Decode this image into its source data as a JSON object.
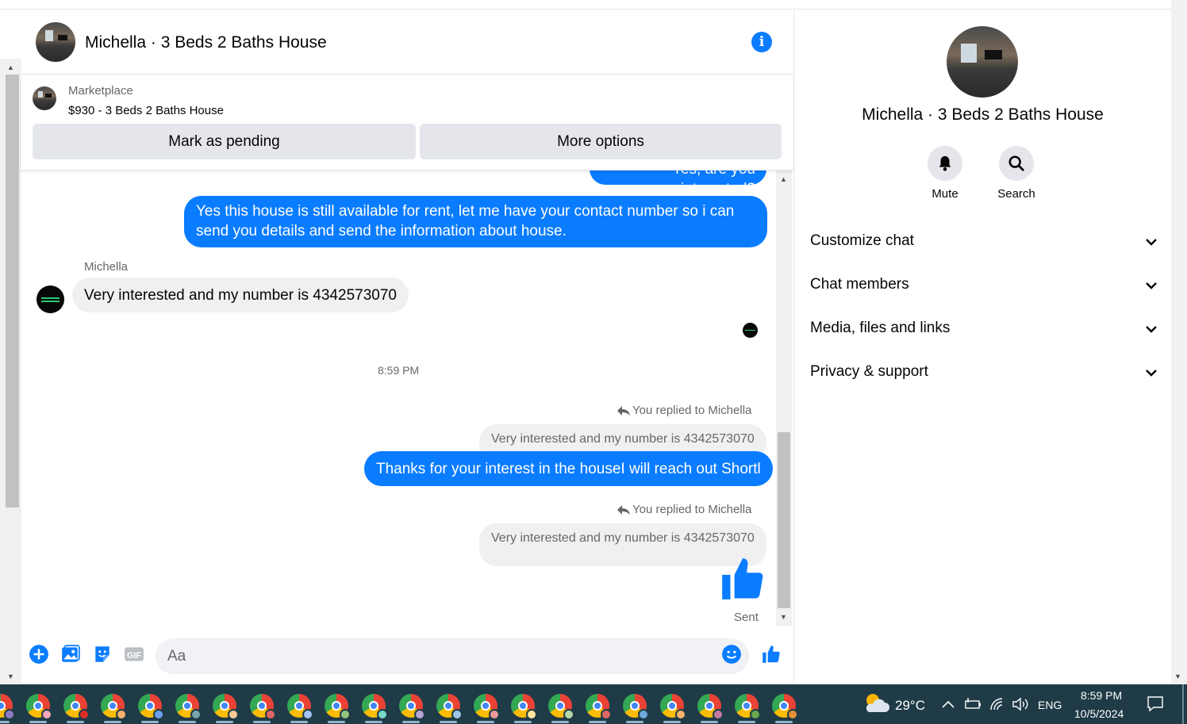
{
  "chat": {
    "title": "Michella · 3 Beds 2 Baths House",
    "marketplace": {
      "label": "Marketplace",
      "listing": "$930 - 3 Beds 2 Baths House",
      "pending_button": "Mark as pending",
      "more_button": "More options"
    },
    "messages": {
      "clipped_out": "Yes, are you interested?",
      "out_1": "Yes this house is still available for rent, let me have your contact number so i can send you details and send the information about house.",
      "sender_name": "Michella",
      "in_1": "Very interested and my number is 4342573070",
      "timestamp": "8:59 PM",
      "reply_note_1": "You replied to Michella",
      "quote_1": "Very interested and my number is 4342573070",
      "out_2": "Thanks for your interest in the houseI will reach out Shortl",
      "reply_note_2": "You replied to Michella",
      "quote_2": "Very interested and my number is 4342573070",
      "status": "Sent"
    },
    "composer": {
      "placeholder": "Aa"
    }
  },
  "right_panel": {
    "name": "Michella · 3 Beds 2 Baths House",
    "actions": [
      {
        "label": "Mute",
        "icon": "bell-icon"
      },
      {
        "label": "Search",
        "icon": "search-icon"
      }
    ],
    "sections": [
      {
        "label": "Customize chat"
      },
      {
        "label": "Chat members"
      },
      {
        "label": "Media, files and links"
      },
      {
        "label": "Privacy & support"
      }
    ]
  },
  "taskbar": {
    "temperature": "29°C",
    "language": "ENG",
    "time": "8:59 PM",
    "date": "10/5/2024",
    "chrome_profile_badges": [
      "#8e7cc3",
      "#f4a7b9",
      "#d93025",
      "#f6b26b",
      "#6d9eeb",
      "#76a5af",
      "#f9cb9c",
      "#e06666",
      "#a4c2f4",
      "#93c47d",
      "#76d7c4",
      "#b4a7d6",
      "#9fc5e8",
      "#ea9999",
      "#ffe599",
      "#b6d7a8",
      "#e06666",
      "#6fa8dc",
      "#f6b26b",
      "#c27ba0",
      "#6aa84f",
      "#e69138"
    ]
  },
  "colors": {
    "messenger_blue": "#0a7cff",
    "bubble_gray": "#f0f0f0",
    "taskbar": "#1f3b47"
  }
}
